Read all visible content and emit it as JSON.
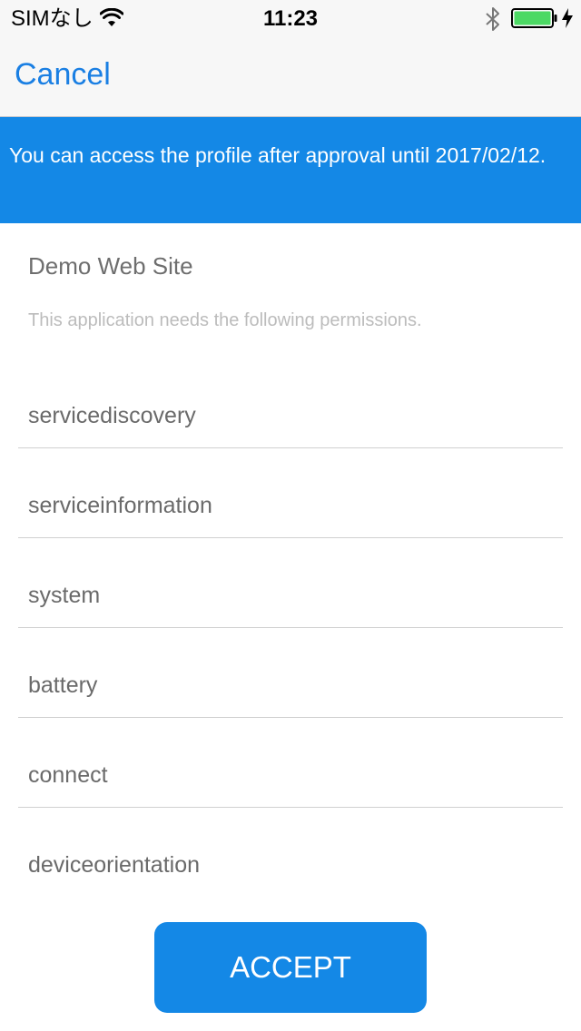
{
  "status_bar": {
    "carrier": "SIMなし",
    "time": "11:23",
    "battery_level": 1.0,
    "battery_color": "#4cd964"
  },
  "nav": {
    "cancel_label": "Cancel"
  },
  "banner": {
    "message": "You can access the profile after approval until 2017/02/12.",
    "background": "#1488e6"
  },
  "content": {
    "site_name": "Demo Web Site",
    "permission_note": "This application needs the following permissions.",
    "permissions": [
      "servicediscovery",
      "serviceinformation",
      "system",
      "battery",
      "connect",
      "deviceorientation"
    ]
  },
  "accept_label": "ACCEPT",
  "colors": {
    "accent": "#1a7fe3"
  }
}
